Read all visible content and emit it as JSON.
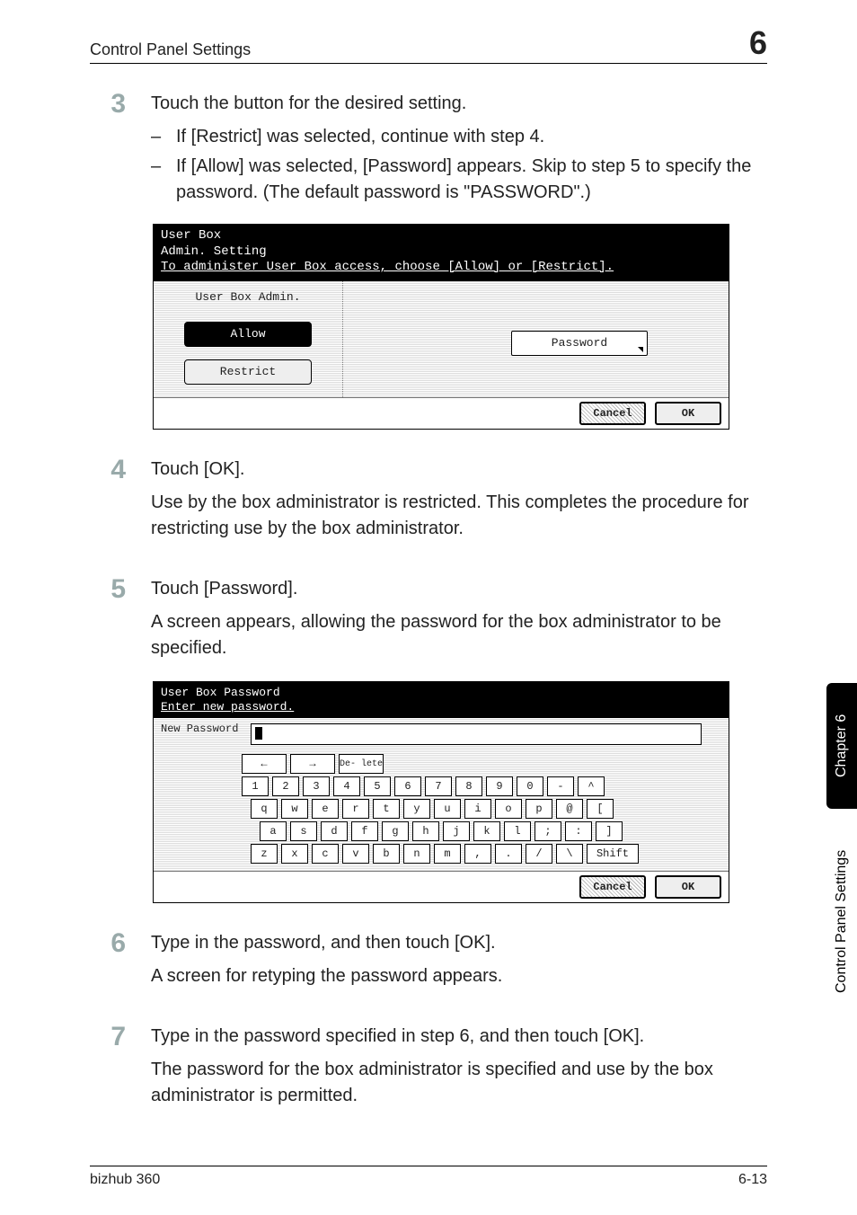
{
  "header": {
    "title": "Control Panel Settings",
    "chapter_number": "6"
  },
  "steps": {
    "s3": {
      "num": "3",
      "lead": "Touch the button for the desired setting.",
      "bullets": [
        "If [Restrict] was selected, continue with step 4.",
        "If [Allow] was selected, [Password] appears. Skip to step 5 to specify the password. (The default password is \"PASSWORD\".)"
      ]
    },
    "s4": {
      "num": "4",
      "lead": "Touch [OK].",
      "para": "Use by the box administrator is restricted. This completes the procedure for restricting use by the box administrator."
    },
    "s5": {
      "num": "5",
      "lead": "Touch [Password].",
      "para": "A screen appears, allowing the password for the box administrator to be specified."
    },
    "s6": {
      "num": "6",
      "lead": "Type in the password, and then touch [OK].",
      "para": "A screen for retyping the password appears."
    },
    "s7": {
      "num": "7",
      "lead": "Type in the password specified in step 6, and then touch [OK].",
      "para": "The password for the box administrator is specified and use by the box administrator is permitted."
    }
  },
  "panel1": {
    "title_line1": "User Box",
    "title_line2": "Admin. Setting",
    "prompt": "To administer User Box access, choose [Allow] or [Restrict].",
    "caption": "User Box Admin.",
    "allow": "Allow",
    "restrict": "Restrict",
    "password": "Password",
    "cancel": "Cancel",
    "ok": "OK"
  },
  "panel2": {
    "title": "User Box Password",
    "prompt": "Enter new password.",
    "field_label": "New\nPassword",
    "arrows_left": "←",
    "arrows_right": "→",
    "delete": "De-\nlete",
    "row_nums": [
      "1",
      "2",
      "3",
      "4",
      "5",
      "6",
      "7",
      "8",
      "9",
      "0",
      "-",
      "^"
    ],
    "row_q": [
      "q",
      "w",
      "e",
      "r",
      "t",
      "y",
      "u",
      "i",
      "o",
      "p",
      "@",
      "["
    ],
    "row_a": [
      "a",
      "s",
      "d",
      "f",
      "g",
      "h",
      "j",
      "k",
      "l",
      ";",
      ":",
      "]"
    ],
    "row_z": [
      "z",
      "x",
      "c",
      "v",
      "b",
      "n",
      "m",
      ",",
      ".",
      "/",
      "\\"
    ],
    "shift": "Shift",
    "cancel": "Cancel",
    "ok": "OK"
  },
  "side": {
    "dark": "Chapter 6",
    "light": "Control Panel Settings"
  },
  "footer": {
    "left": "bizhub 360",
    "right": "6-13"
  }
}
